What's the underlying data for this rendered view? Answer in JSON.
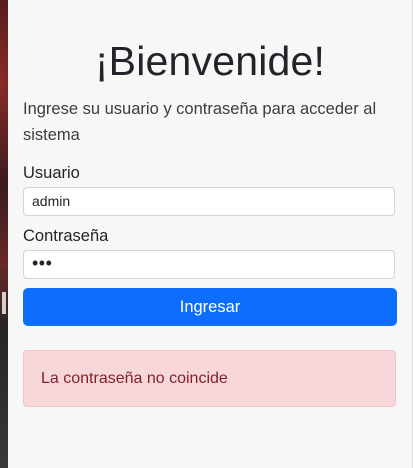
{
  "login": {
    "title": "¡Bienvenide!",
    "subtitle": "Ingrese su usuario y contraseña para acceder al sistema",
    "username_label": "Usuario",
    "username_value": "admin",
    "password_label": "Contraseña",
    "password_masked": "•••",
    "submit_label": "Ingresar",
    "error_message": "La contraseña no coincide"
  },
  "colors": {
    "primary_button": "#0d6efd",
    "alert_background": "#f8d7da",
    "alert_text": "#842029"
  }
}
